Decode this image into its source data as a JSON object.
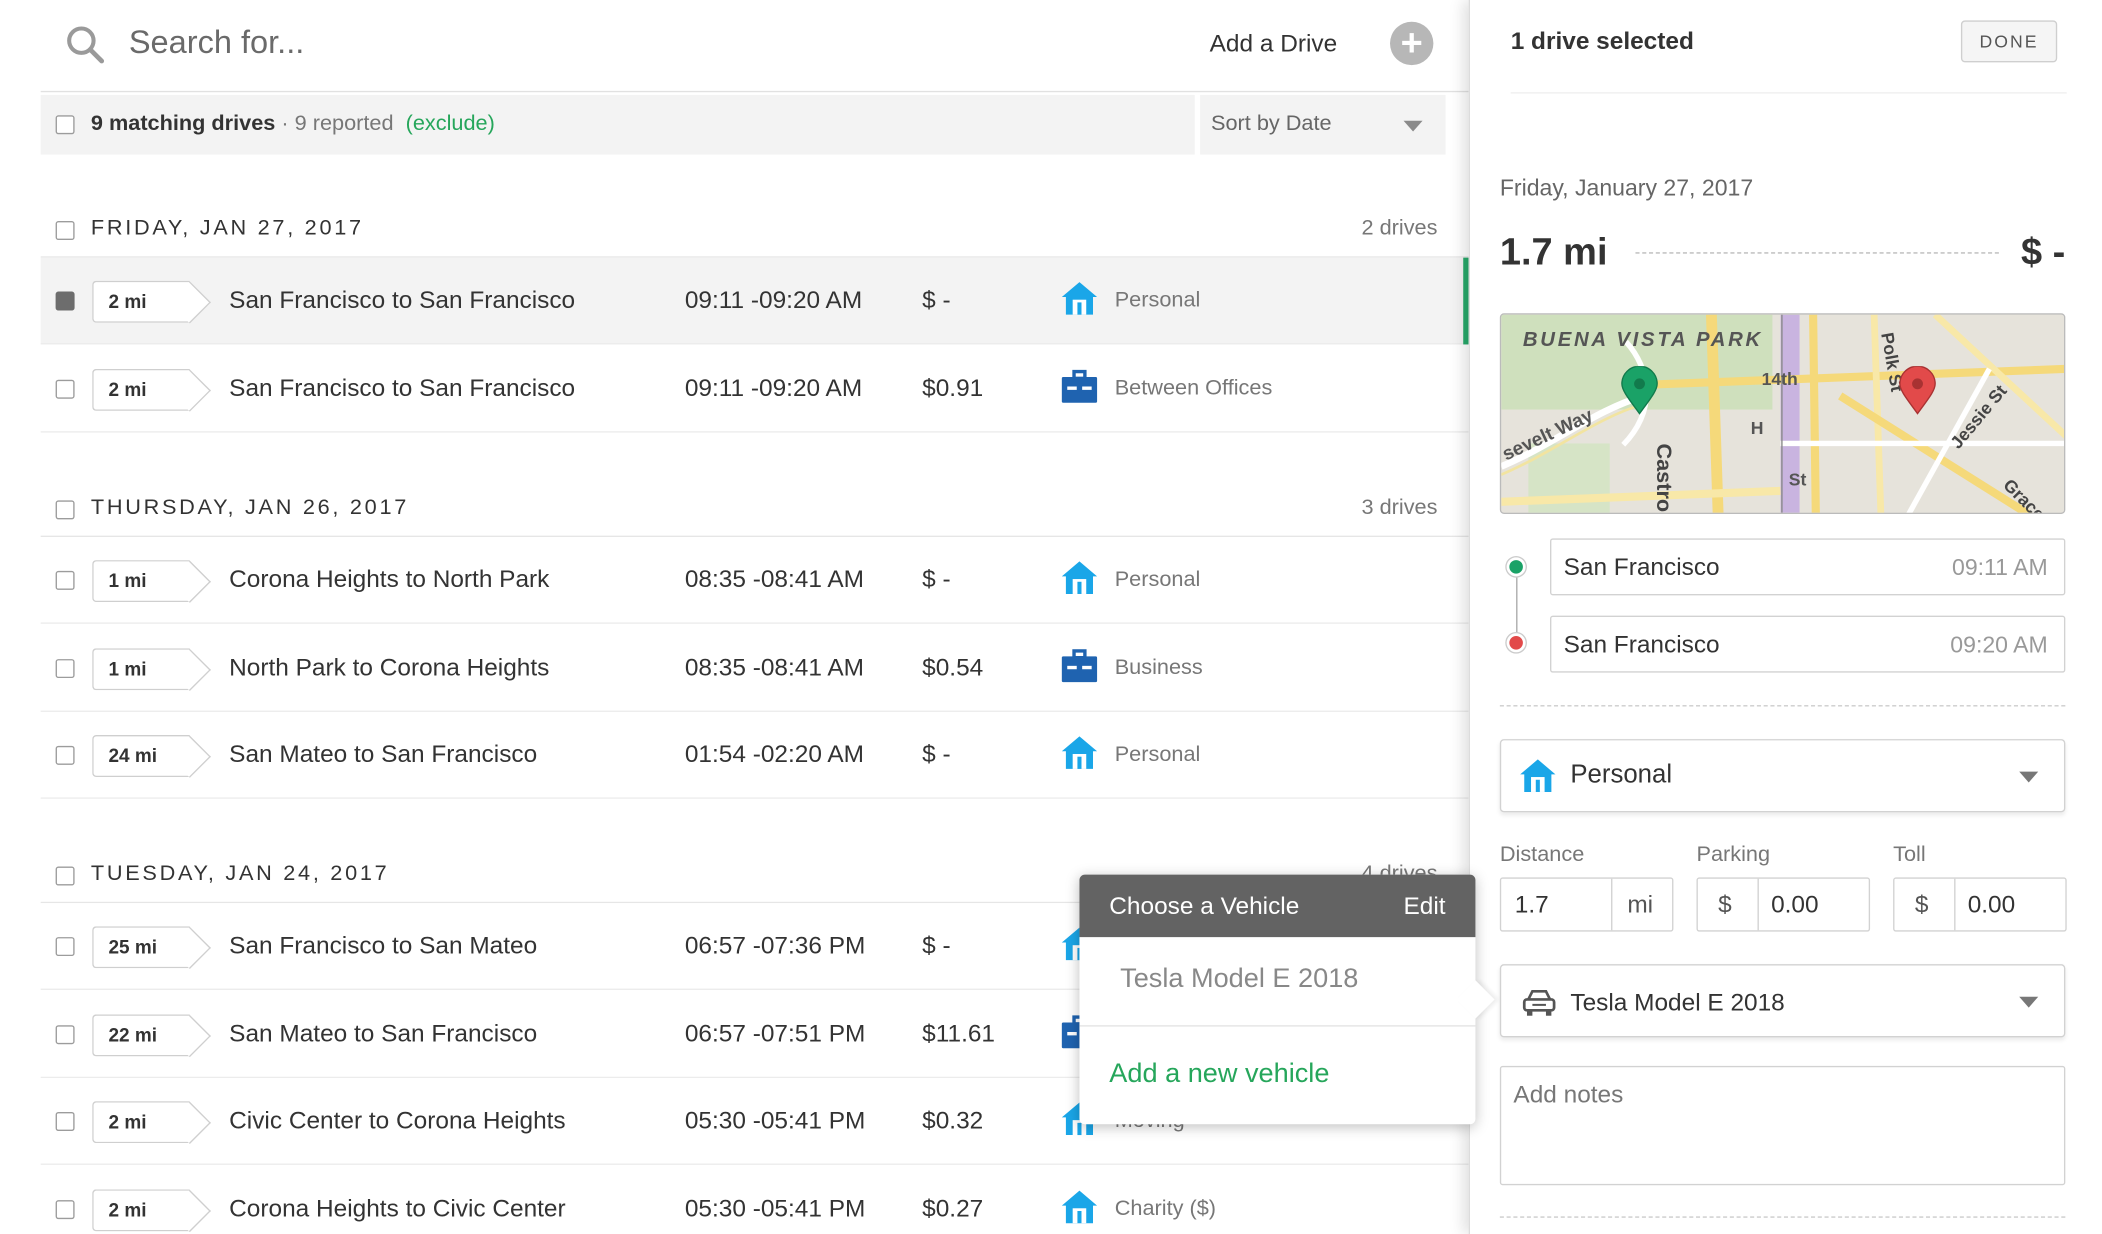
{
  "search": {
    "placeholder": "Search for...",
    "add_drive_label": "Add a Drive"
  },
  "filter": {
    "count": "9 matching drives",
    "separator": " · ",
    "reported": "9 reported",
    "exclude": "(exclude)",
    "sort_label": "Sort by Date"
  },
  "days": [
    {
      "title": "FRIDAY, JAN 27, 2017",
      "count": "2 drives"
    },
    {
      "title": "THURSDAY, JAN 26, 2017",
      "count": "3 drives"
    },
    {
      "title": "TUESDAY, JAN 24, 2017",
      "count": "4 drives"
    }
  ],
  "drives": [
    {
      "mi": "2 mi",
      "route": "San Francisco to San Francisco",
      "time": "09:11 -09:20 AM",
      "amount": "$ -",
      "category": "Personal",
      "icon": "house-icon",
      "selected": true
    },
    {
      "mi": "2 mi",
      "route": "San Francisco to San Francisco",
      "time": "09:11 -09:20 AM",
      "amount": "$0.91",
      "category": "Between Offices",
      "icon": "briefcase-icon",
      "selected": false
    },
    {
      "mi": "1 mi",
      "route": "Corona Heights to North Park",
      "time": "08:35 -08:41 AM",
      "amount": "$ -",
      "category": "Personal",
      "icon": "house-icon",
      "selected": false
    },
    {
      "mi": "1 mi",
      "route": "North Park to Corona Heights",
      "time": "08:35 -08:41 AM",
      "amount": "$0.54",
      "category": "Business",
      "icon": "briefcase-icon",
      "selected": false
    },
    {
      "mi": "24 mi",
      "route": "San Mateo to San Francisco",
      "time": "01:54 -02:20 AM",
      "amount": "$ -",
      "category": "Personal",
      "icon": "house-icon",
      "selected": false
    },
    {
      "mi": "25 mi",
      "route": "San Francisco to San Mateo",
      "time": "06:57 -07:36 PM",
      "amount": "$ -",
      "category": "",
      "icon": "house-icon",
      "selected": false
    },
    {
      "mi": "22 mi",
      "route": "San Mateo to San Francisco",
      "time": "06:57 -07:51 PM",
      "amount": "$11.61",
      "category": "",
      "icon": "briefcase-icon",
      "selected": false
    },
    {
      "mi": "2 mi",
      "route": "Civic Center to Corona Heights",
      "time": "05:30 -05:41 PM",
      "amount": "$0.32",
      "category": "Moving",
      "icon": "house-icon",
      "selected": false
    },
    {
      "mi": "2 mi",
      "route": "Corona Heights to Civic Center",
      "time": "05:30 -05:41 PM",
      "amount": "$0.27",
      "category": "Charity ($)",
      "icon": "house-icon",
      "selected": false
    }
  ],
  "vehicle_popover": {
    "title": "Choose a Vehicle",
    "edit": "Edit",
    "option": "Tesla Model E 2018",
    "add": "Add a new vehicle"
  },
  "detail": {
    "title": "1 drive selected",
    "done": "DONE",
    "date": "Friday, January 27, 2017",
    "distance": "1.7 mi",
    "value": "$ -",
    "map_labels": [
      "BUENA VISTA PARK",
      "14th",
      "Castro St",
      "Polk St",
      "Jessie St",
      "Grace",
      "sevelt Way",
      "H",
      "St"
    ],
    "start": {
      "place": "San Francisco",
      "time": "09:11 AM"
    },
    "end": {
      "place": "San Francisco",
      "time": "09:20 AM"
    },
    "category": "Personal",
    "distance_label": "Distance",
    "distance_value": "1.7",
    "distance_unit": "mi",
    "parking_label": "Parking",
    "parking_currency": "$",
    "parking_value": "0.00",
    "toll_label": "Toll",
    "toll_currency": "$",
    "toll_value": "0.00",
    "vehicle": "Tesla Model E 2018",
    "notes_placeholder": "Add notes"
  },
  "colors": {
    "accent_green": "#26a65b",
    "icon_blue": "#1aa6e8",
    "briefcase_blue": "#1f63b0",
    "start_pin": "#1aa267",
    "end_pin": "#e24a4a"
  }
}
